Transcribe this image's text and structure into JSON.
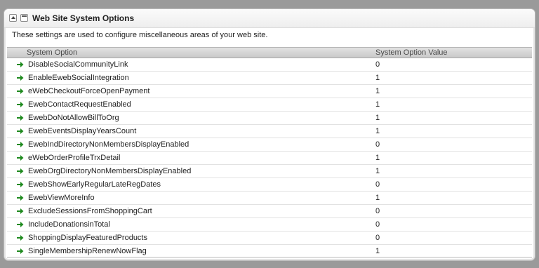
{
  "panel": {
    "title": "Web Site System Options",
    "description": "These settings are used to configure miscellaneous areas of your web site."
  },
  "grid": {
    "columns": [
      "System Option",
      "System Option Value"
    ],
    "rows": [
      {
        "name": "DisableSocialCommunityLink",
        "value": "0"
      },
      {
        "name": "EnableEwebSocialIntegration",
        "value": "1"
      },
      {
        "name": "eWebCheckoutForceOpenPayment",
        "value": "1"
      },
      {
        "name": "EwebContactRequestEnabled",
        "value": "1"
      },
      {
        "name": "EwebDoNotAllowBillToOrg",
        "value": "1"
      },
      {
        "name": "EwebEventsDisplayYearsCount",
        "value": "1"
      },
      {
        "name": "EwebIndDirectoryNonMembersDisplayEnabled",
        "value": "0"
      },
      {
        "name": "eWebOrderProfileTrxDetail",
        "value": "1"
      },
      {
        "name": "EwebOrgDirectoryNonMembersDisplayEnabled",
        "value": "1"
      },
      {
        "name": "EwebShowEarlyRegularLateRegDates",
        "value": "0"
      },
      {
        "name": "EwebViewMoreInfo",
        "value": "1"
      },
      {
        "name": "ExcludeSessionsFromShoppingCart",
        "value": "0"
      },
      {
        "name": "IncludeDonationsinTotal",
        "value": "0"
      },
      {
        "name": "ShoppingDisplayFeaturedProducts",
        "value": "0"
      },
      {
        "name": "SingleMembershipRenewNowFlag",
        "value": "1"
      }
    ]
  },
  "icons": {
    "row_icon": "green-arrow-right-icon",
    "collapse": "collapse-up-icon",
    "window": "window-icon"
  },
  "colors": {
    "arrow": "#1f8a1f"
  }
}
